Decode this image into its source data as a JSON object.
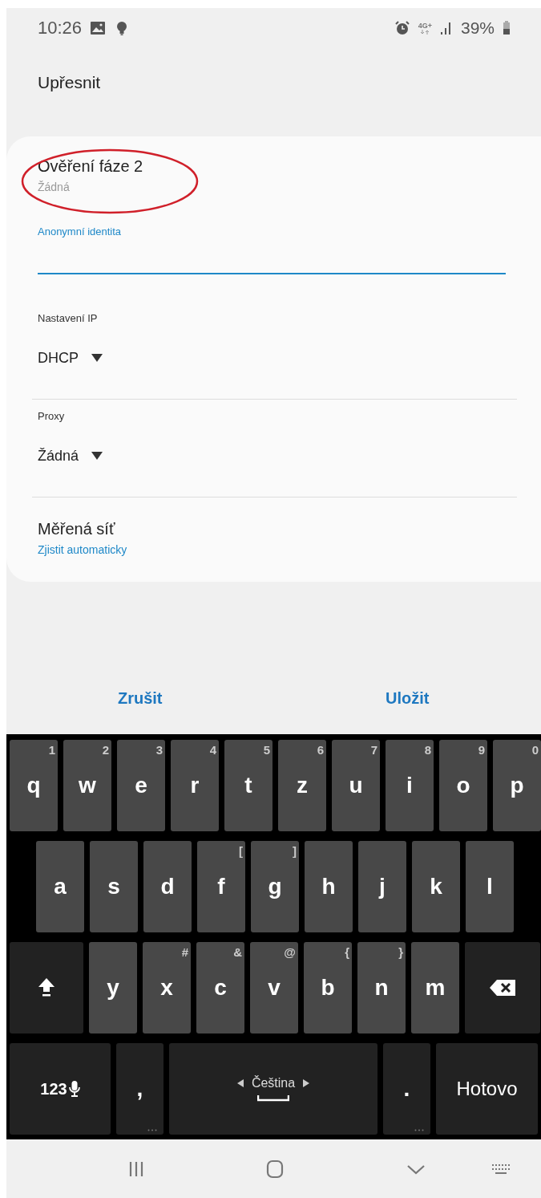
{
  "status_bar": {
    "time": "10:26",
    "network": "4G+",
    "battery": "39%"
  },
  "header": {
    "title": "Upřesnit"
  },
  "settings": [
    {
      "kind": "summary",
      "label": "Ověření fáze 2",
      "value": "Žádná",
      "accent": false,
      "highlighted": true
    },
    {
      "kind": "input",
      "label": "Anonymní identita",
      "focused": true
    },
    {
      "kind": "dropdown",
      "label": "Nastavení IP",
      "value": "DHCP"
    },
    {
      "kind": "dropdown",
      "label": "Proxy",
      "value": "Žádná"
    },
    {
      "kind": "summary",
      "label": "Měřená síť",
      "value": "Zjistit automaticky",
      "accent": true,
      "highlighted": false
    }
  ],
  "actions": [
    "Zrušit",
    "Uložit"
  ],
  "keyboard": {
    "rows": [
      {
        "keys": [
          {
            "kind": "letter",
            "label": "q",
            "hint": "1"
          },
          {
            "kind": "letter",
            "label": "w",
            "hint": "2"
          },
          {
            "kind": "letter",
            "label": "e",
            "hint": "3"
          },
          {
            "kind": "letter",
            "label": "r",
            "hint": "4"
          },
          {
            "kind": "letter",
            "label": "t",
            "hint": "5"
          },
          {
            "kind": "letter",
            "label": "z",
            "hint": "6"
          },
          {
            "kind": "letter",
            "label": "u",
            "hint": "7"
          },
          {
            "kind": "letter",
            "label": "i",
            "hint": "8"
          },
          {
            "kind": "letter",
            "label": "o",
            "hint": "9"
          },
          {
            "kind": "letter",
            "label": "p",
            "hint": "0"
          }
        ]
      },
      {
        "keys": [
          {
            "kind": "letter",
            "label": "a"
          },
          {
            "kind": "letter",
            "label": "s"
          },
          {
            "kind": "letter",
            "label": "d"
          },
          {
            "kind": "letter",
            "label": "f",
            "hint": "["
          },
          {
            "kind": "letter",
            "label": "g",
            "hint": "]"
          },
          {
            "kind": "letter",
            "label": "h"
          },
          {
            "kind": "letter",
            "label": "j"
          },
          {
            "kind": "letter",
            "label": "k"
          },
          {
            "kind": "letter",
            "label": "l"
          }
        ]
      },
      {
        "keys": [
          {
            "kind": "shift"
          },
          {
            "kind": "letter",
            "label": "y"
          },
          {
            "kind": "letter",
            "label": "x",
            "hint": "#"
          },
          {
            "kind": "letter",
            "label": "c",
            "hint": "&"
          },
          {
            "kind": "letter",
            "label": "v",
            "hint": "@"
          },
          {
            "kind": "letter",
            "label": "b",
            "hint": "{"
          },
          {
            "kind": "letter",
            "label": "n",
            "hint": "}"
          },
          {
            "kind": "letter",
            "label": "m"
          },
          {
            "kind": "backspace"
          }
        ]
      },
      {
        "keys": [
          {
            "kind": "symbols",
            "label": "123"
          },
          {
            "kind": "punct",
            "label": ","
          },
          {
            "kind": "space",
            "label": "Čeština"
          },
          {
            "kind": "punct",
            "label": "."
          },
          {
            "kind": "action",
            "label": "Hotovo"
          }
        ]
      }
    ]
  }
}
